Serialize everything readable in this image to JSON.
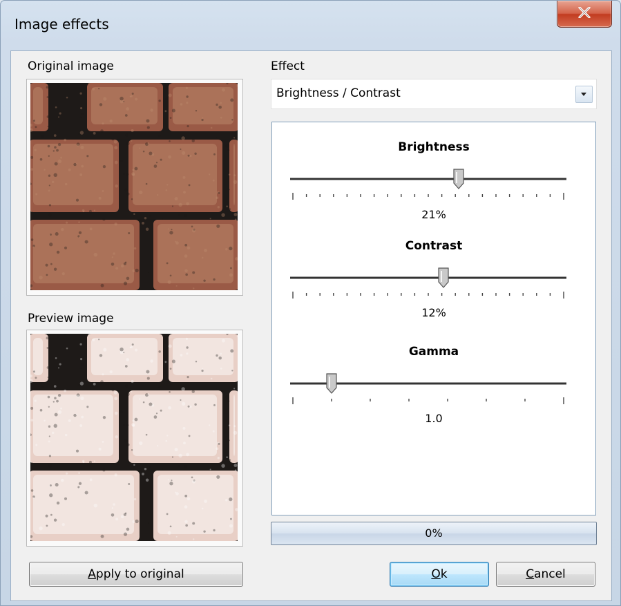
{
  "window": {
    "title": "Image effects",
    "close_icon": "close-x-icon"
  },
  "left": {
    "original_label": "Original image",
    "preview_label": "Preview image",
    "apply_button": {
      "accel": "A",
      "rest": "pply to original"
    }
  },
  "effect": {
    "label": "Effect",
    "selected": "Brightness / Contrast",
    "dropdown_icon": "chevron-down-icon"
  },
  "sliders": [
    {
      "title": "Brightness",
      "value_text": "21%",
      "position": 0.61,
      "ticks": 21
    },
    {
      "title": "Contrast",
      "value_text": "12%",
      "position": 0.555,
      "ticks": 21
    },
    {
      "title": "Gamma",
      "value_text": "1.0",
      "position": 0.15,
      "ticks": 8
    }
  ],
  "progress": {
    "text": "0%",
    "value": 0
  },
  "buttons": {
    "ok": {
      "accel": "O",
      "rest": "k"
    },
    "cancel": {
      "accel": "C",
      "rest": "ancel"
    }
  },
  "colors": {
    "brick_original": "#9a5a46",
    "brick_preview": "#e8cfc6",
    "mortar": "#1e1a18"
  }
}
